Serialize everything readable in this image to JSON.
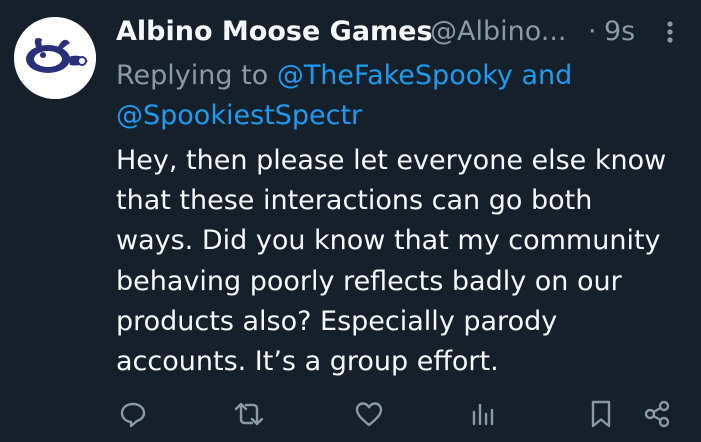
{
  "tweet": {
    "author": {
      "display_name": "Albino Moose Games",
      "handle": "@Albino...",
      "avatar_icon": "moose-logo-avatar"
    },
    "separator": "·",
    "timestamp": "9s",
    "reply": {
      "prefix": "Replying to",
      "mention_1": "@TheFakeSpooky",
      "conjunction": "and",
      "mention_2": "@SpookiestSpectr"
    },
    "body_lines": [
      "Hey, then please let everyone else know",
      "that these interactions can go both",
      "ways. Did you know that my community",
      "behaving poorly reflects badly on our",
      "products also? Especially parody",
      "accounts. It’s a group effort."
    ],
    "actions": [
      {
        "name": "reply",
        "icon": "speech-bubble-icon"
      },
      {
        "name": "retweet",
        "icon": "retweet-icon"
      },
      {
        "name": "like",
        "icon": "heart-icon"
      },
      {
        "name": "views",
        "icon": "bar-chart-icon"
      },
      {
        "name": "bookmark",
        "icon": "bookmark-icon"
      },
      {
        "name": "share",
        "icon": "share-icon"
      }
    ]
  },
  "colors": {
    "background": "#15202b",
    "text_primary": "#f7f9f9",
    "text_secondary": "#8b98a5",
    "link": "#1d9bf0"
  }
}
